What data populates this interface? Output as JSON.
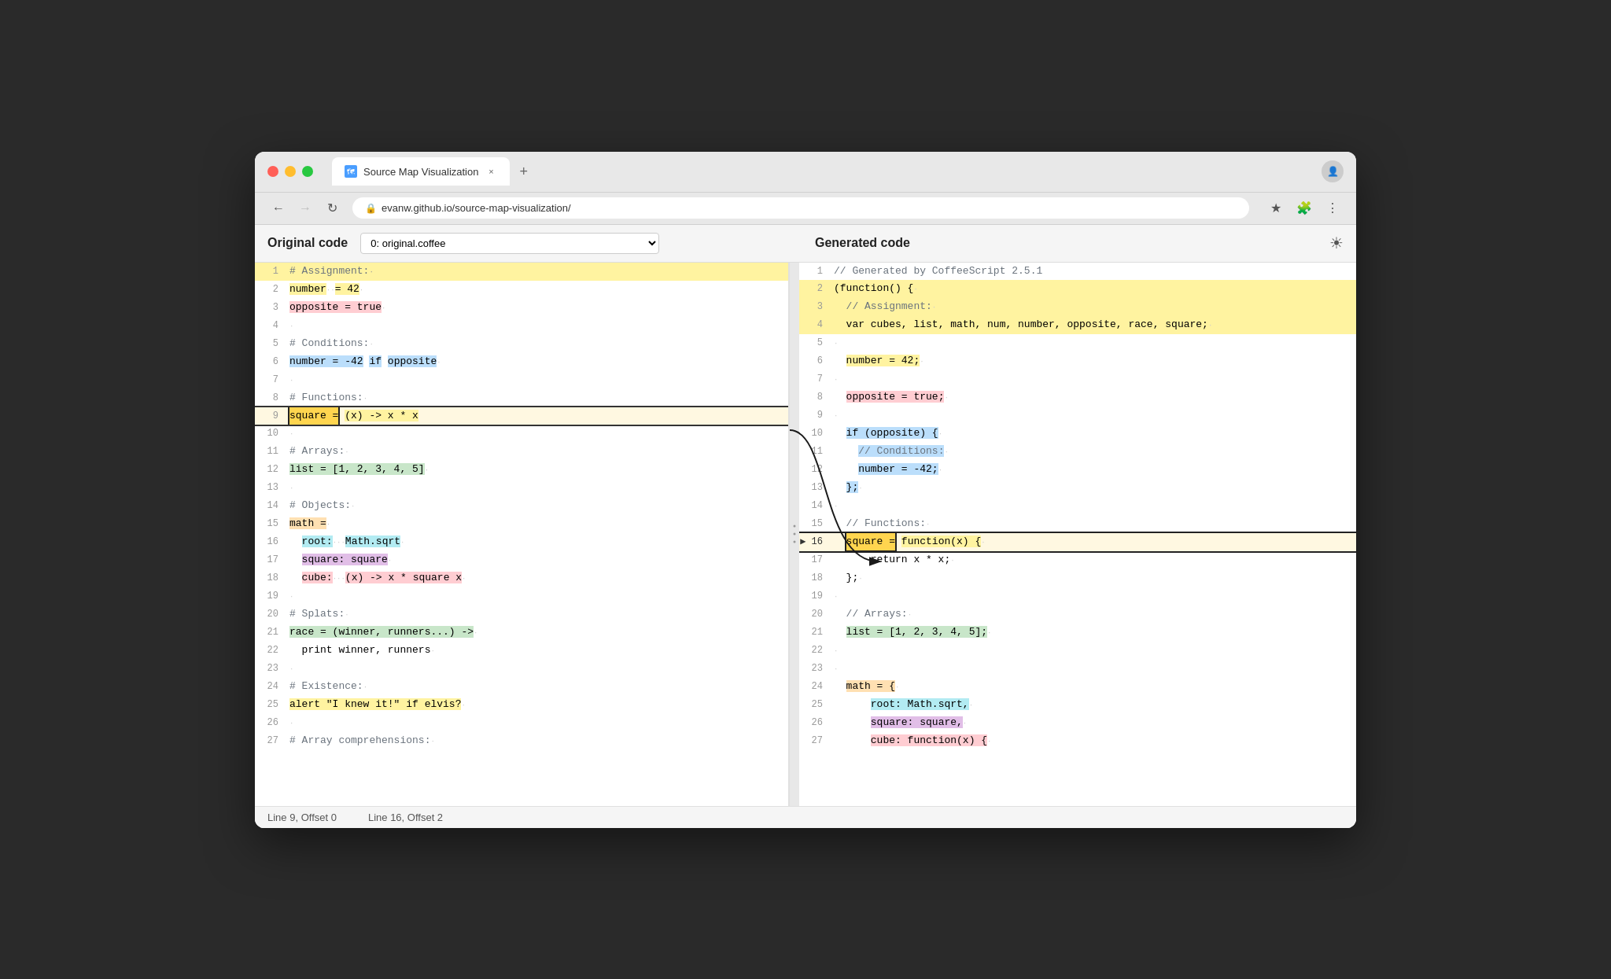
{
  "browser": {
    "tab_title": "Source Map Visualization",
    "tab_close": "×",
    "tab_new": "+",
    "url": "evanw.github.io/source-map-visualization/",
    "nav_back": "←",
    "nav_forward": "→",
    "nav_refresh": "↻"
  },
  "header": {
    "left_title": "Original code",
    "right_title": "Generated code",
    "file_selector": "0: original.coffee",
    "sun_icon": "☀"
  },
  "left_panel": {
    "lines": [
      {
        "num": "1",
        "content": "# Assignment:",
        "highlight": "yellow"
      },
      {
        "num": "2",
        "content": "number·· = 42·",
        "highlight": "yellow"
      },
      {
        "num": "3",
        "content": "opposite = true·",
        "highlight": "pink"
      },
      {
        "num": "4",
        "content": "·"
      },
      {
        "num": "5",
        "content": "# Conditions:·"
      },
      {
        "num": "6",
        "content": "number = -42·if·opposite·",
        "highlight": "blue"
      },
      {
        "num": "7",
        "content": "·"
      },
      {
        "num": "8",
        "content": "# Functions:·"
      },
      {
        "num": "9",
        "content": "square = (x) -> x·*·x",
        "highlight": "selected"
      },
      {
        "num": "10",
        "content": "·"
      },
      {
        "num": "11",
        "content": "# Arrays:·"
      },
      {
        "num": "12",
        "content": "list = [1, 2, 3, 4, 5]·",
        "highlight": "green"
      },
      {
        "num": "13",
        "content": "·"
      },
      {
        "num": "14",
        "content": "# Objects:·"
      },
      {
        "num": "15",
        "content": "math =·",
        "highlight": "orange"
      },
      {
        "num": "16",
        "content": "··root:···Math.sqrt·",
        "highlight": "teal"
      },
      {
        "num": "17",
        "content": "··square: square·",
        "highlight": "purple"
      },
      {
        "num": "18",
        "content": "··cube:···(x) -> x·*·square·x·",
        "highlight": "pink"
      },
      {
        "num": "19",
        "content": "·"
      },
      {
        "num": "20",
        "content": "# Splats:·"
      },
      {
        "num": "21",
        "content": "race = (winner, runners...) ->·",
        "highlight": "green"
      },
      {
        "num": "22",
        "content": "··print winner, runners·"
      },
      {
        "num": "23",
        "content": "·"
      },
      {
        "num": "24",
        "content": "# Existence:·"
      },
      {
        "num": "25",
        "content": "alert \"I knew it!\"·if·elvis?·",
        "highlight": "yellow"
      },
      {
        "num": "26",
        "content": "·"
      },
      {
        "num": "27",
        "content": "# Array comprehensions:·"
      }
    ]
  },
  "right_panel": {
    "lines": [
      {
        "num": "1",
        "content": "// Generated by CoffeeScript 2.5.1"
      },
      {
        "num": "2",
        "content": "(function()·{",
        "highlight": "yellow"
      },
      {
        "num": "3",
        "content": "··// Assignment:",
        "highlight": "yellow"
      },
      {
        "num": "4",
        "content": "··var cubes, list, math, num, number, opposite, race, square;",
        "highlight": "yellow"
      },
      {
        "num": "5",
        "content": "·"
      },
      {
        "num": "6",
        "content": "··number = 42;",
        "highlight": "yellow"
      },
      {
        "num": "7",
        "content": "·"
      },
      {
        "num": "8",
        "content": "··opposite = true;",
        "highlight": "pink"
      },
      {
        "num": "9",
        "content": "·"
      },
      {
        "num": "10",
        "content": "··if (opposite)·{",
        "highlight": "blue"
      },
      {
        "num": "11",
        "content": "····// Conditions:",
        "highlight": "blue"
      },
      {
        "num": "12",
        "content": "····number = -42;",
        "highlight": "blue"
      },
      {
        "num": "13",
        "content": "··};",
        "highlight": "blue"
      },
      {
        "num": "14",
        "content": "·"
      },
      {
        "num": "15",
        "content": "··// Functions:"
      },
      {
        "num": "16",
        "content": "··square = function(x)·{",
        "highlight": "selected"
      },
      {
        "num": "17",
        "content": "······return x·*·x;"
      },
      {
        "num": "18",
        "content": "··};"
      },
      {
        "num": "19",
        "content": "·"
      },
      {
        "num": "20",
        "content": "··// Arrays:"
      },
      {
        "num": "21",
        "content": "··list = [1, 2, 3, 4, 5];",
        "highlight": "green"
      },
      {
        "num": "22",
        "content": "·"
      },
      {
        "num": "23",
        "content": "·"
      },
      {
        "num": "24",
        "content": "··math = {",
        "highlight": "orange"
      },
      {
        "num": "25",
        "content": "······root: Math.sqrt,",
        "highlight": "teal"
      },
      {
        "num": "26",
        "content": "······square: square,",
        "highlight": "purple"
      },
      {
        "num": "27",
        "content": "······cube: function(x)·{",
        "highlight": "pink"
      }
    ]
  },
  "status_bar": {
    "left": "Line 9, Offset 0",
    "right": "Line 16, Offset 2"
  },
  "highlights": {
    "assignment_label": "Assignment :",
    "conditions_label": "Conditions",
    "function_label": "function",
    "math_label_left": "math",
    "math_label_right": "math"
  }
}
